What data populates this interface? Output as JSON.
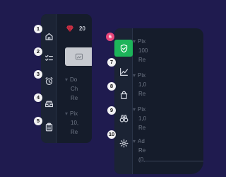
{
  "left_panel": {
    "nav": [
      {
        "badge": "1",
        "icon": "home-icon"
      },
      {
        "badge": "2",
        "icon": "checklist-icon"
      },
      {
        "badge": "3",
        "icon": "alarm-clock-icon"
      },
      {
        "badge": "4",
        "icon": "inbox-icon"
      },
      {
        "badge": "5",
        "icon": "clipboard-icon"
      }
    ],
    "gem_count": "20",
    "lines": [
      "Do",
      "Ch",
      "Re",
      "Pix",
      "10,",
      "Re"
    ]
  },
  "right_panel": {
    "nav": [
      {
        "badge": "6",
        "icon": "shield-icon",
        "active": true
      },
      {
        "badge": "7",
        "icon": "chart-icon"
      },
      {
        "badge": "8",
        "icon": "shopping-bag-icon"
      },
      {
        "badge": "9",
        "icon": "binoculars-icon"
      },
      {
        "badge": "10",
        "icon": "gear-icon"
      }
    ],
    "lines": [
      "Pix",
      "100",
      "Re",
      "Pix",
      "1,0",
      "Re",
      "Pix",
      "1,0",
      "Re",
      "Ad",
      "Re",
      "(0,"
    ]
  },
  "colors": {
    "background": "#1f1b4f",
    "panel": "#151c2b",
    "active": "#1db45a",
    "badge_active": "#e8457a",
    "gem": "#d9354a"
  }
}
